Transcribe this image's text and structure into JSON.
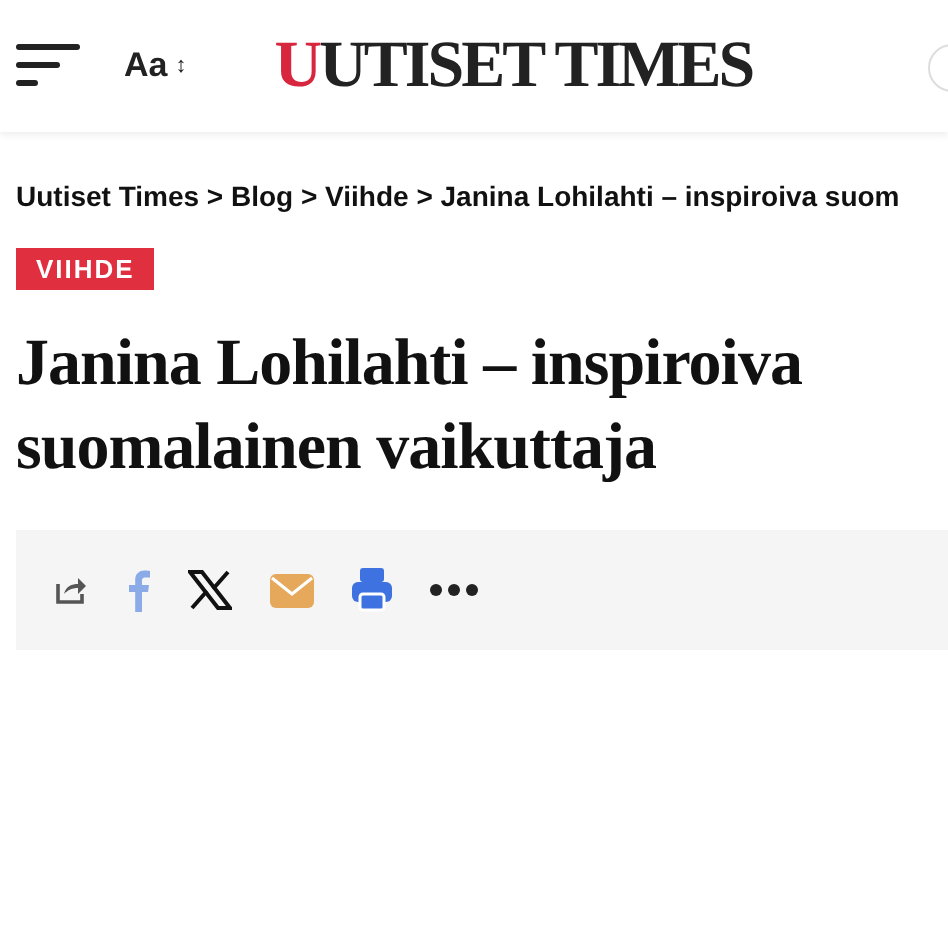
{
  "header": {
    "font_size_label": "Aa",
    "font_size_symbol": "↕",
    "logo": {
      "accent": "U",
      "rest": "UTISET TIMES"
    }
  },
  "breadcrumb": "Uutiset Times > Blog > Viihde > Janina Lohilahti – inspiroiva suom",
  "category": "VIIHDE",
  "title": "Janina Lohilahti – inspiroiva suomalainen vaikuttaja",
  "share": [
    {
      "kind": "share"
    },
    {
      "kind": "facebook"
    },
    {
      "kind": "x"
    },
    {
      "kind": "email"
    },
    {
      "kind": "print"
    },
    {
      "kind": "more"
    }
  ]
}
